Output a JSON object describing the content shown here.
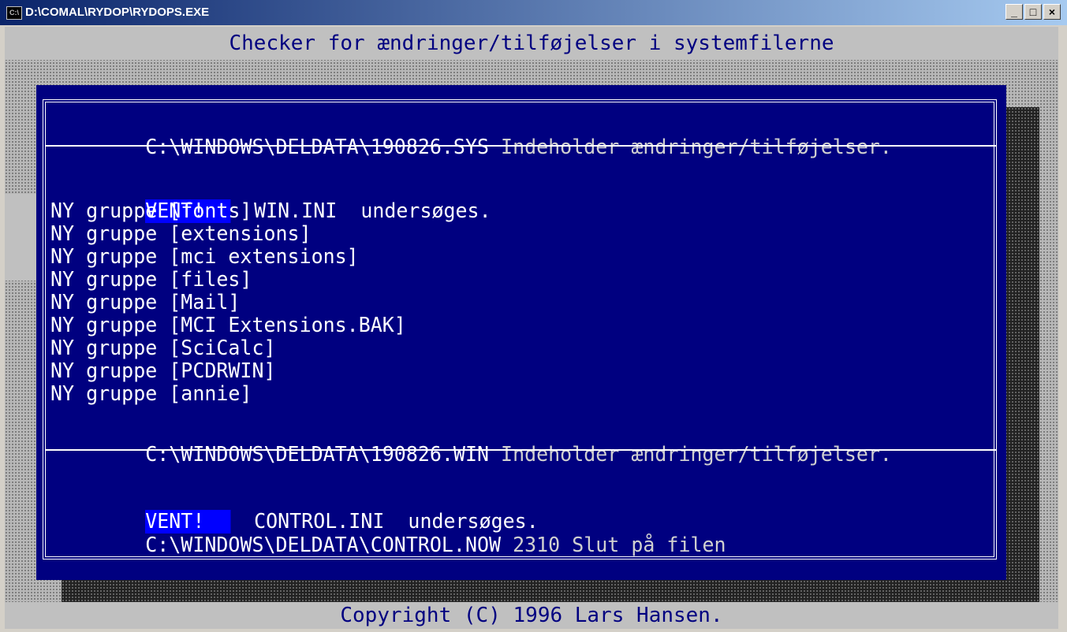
{
  "window": {
    "title": "D:\\COMAL\\RYDOP\\RYDOPS.EXE",
    "icon": "console-icon",
    "buttons": {
      "minimize": "_",
      "maximize": "□",
      "close": "×"
    }
  },
  "console": {
    "header": "Checker for ændringer/tilføjelser i systemfilerne",
    "footer": "Copyright (C) 1996 Lars Hansen.",
    "colors": {
      "background": "#000080",
      "text": "#ffffff",
      "highlight": "#0000ff",
      "bar": "#c0c0c0"
    }
  },
  "dialog": {
    "line1_path": "C:\\WINDOWS\\DELDATA\\190826.SYS",
    "line1_msg": " Indeholder ændringer/tilføjelser.",
    "win_vent": "VENT!",
    "win_check": "  WIN.INI  undersøges.",
    "groups": [
      "NY gruppe [fonts]",
      "NY gruppe [extensions]",
      "NY gruppe [mci extensions]",
      "NY gruppe [files]",
      "NY gruppe [Mail]",
      "NY gruppe [MCI Extensions.BAK]",
      "NY gruppe [SciCalc]",
      "NY gruppe [PCDRWIN]",
      "NY gruppe [annie]"
    ],
    "line2_path": "C:\\WINDOWS\\DELDATA\\190826.WIN",
    "line2_msg": " Indeholder ændringer/tilføjelser.",
    "ctl_vent": "VENT!",
    "ctl_check": "  CONTROL.INI  undersøges.",
    "line3_path": "C:\\WINDOWS\\DELDATA\\CONTROL.NOW",
    "line3_msg": " 2310 Slut på filen"
  }
}
